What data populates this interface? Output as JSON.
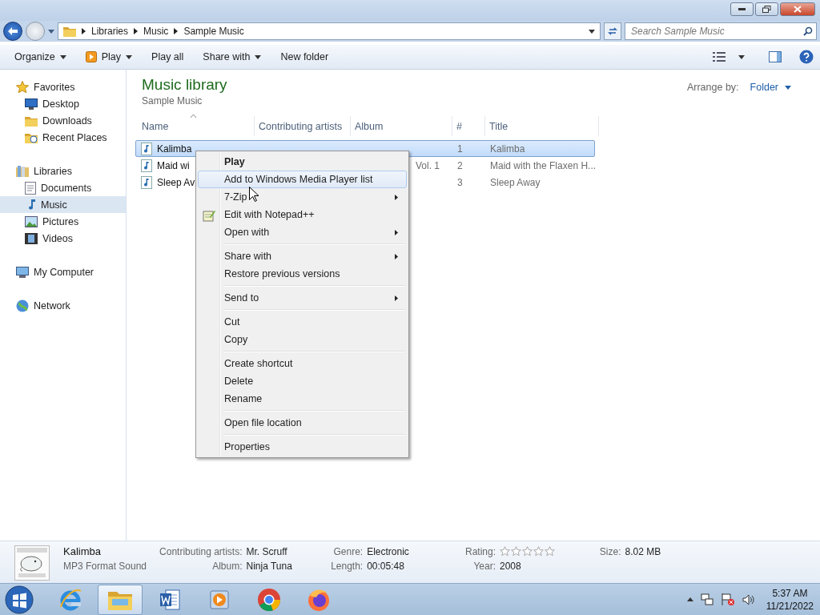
{
  "address": {
    "crumbs": [
      "Libraries",
      "Music",
      "Sample Music"
    ],
    "search_placeholder": "Search Sample Music"
  },
  "toolbar": {
    "items": [
      {
        "label": "Organize",
        "dropdown": true,
        "icon": false
      },
      {
        "label": "Play",
        "dropdown": true,
        "icon": true
      },
      {
        "label": "Play all",
        "dropdown": false,
        "icon": false
      },
      {
        "label": "Share with",
        "dropdown": true,
        "icon": false
      },
      {
        "label": "New folder",
        "dropdown": false,
        "icon": false
      }
    ]
  },
  "sidebar": {
    "groups": [
      {
        "label": "Favorites",
        "children": [
          {
            "label": "Desktop",
            "selected": false
          },
          {
            "label": "Downloads",
            "selected": false
          },
          {
            "label": "Recent Places",
            "selected": false
          }
        ]
      },
      {
        "label": "Libraries",
        "children": [
          {
            "label": "Documents",
            "selected": false
          },
          {
            "label": "Music",
            "selected": true
          },
          {
            "label": "Pictures",
            "selected": false
          },
          {
            "label": "Videos",
            "selected": false
          }
        ]
      },
      {
        "label": "My Computer"
      },
      {
        "label": "Network"
      }
    ]
  },
  "library": {
    "title": "Music library",
    "subtitle": "Sample Music",
    "arrange_label": "Arrange by:",
    "arrange_value": "Folder",
    "columns": [
      "Name",
      "Contributing artists",
      "Album",
      "#",
      "Title"
    ],
    "rows": [
      {
        "name": "Kalimba",
        "number": "1",
        "title": "Kalimba",
        "selected": true
      },
      {
        "name": "Maid wi",
        "album": "Vol. 1",
        "number": "2",
        "title": "Maid with the Flaxen H...",
        "selected": false
      },
      {
        "name": "Sleep Av",
        "number": "3",
        "title": "Sleep Away",
        "selected": false
      }
    ]
  },
  "context_menu": {
    "groups": [
      [
        {
          "label": "Play",
          "default": true,
          "submenu": false,
          "icon": false,
          "selected": false
        },
        {
          "label": "Add to Windows Media Player list",
          "default": false,
          "submenu": false,
          "icon": false,
          "selected": true
        },
        {
          "label": "7-Zip",
          "default": false,
          "submenu": true,
          "icon": false,
          "selected": false
        },
        {
          "label": "Edit with Notepad++",
          "default": false,
          "submenu": false,
          "icon": true,
          "selected": false
        },
        {
          "label": "Open with",
          "default": false,
          "submenu": true,
          "icon": false,
          "selected": false
        }
      ],
      [
        {
          "label": "Share with",
          "default": false,
          "submenu": true,
          "icon": false,
          "selected": false
        },
        {
          "label": "Restore previous versions",
          "default": false,
          "submenu": false,
          "icon": false,
          "selected": false
        }
      ],
      [
        {
          "label": "Send to",
          "default": false,
          "submenu": true,
          "icon": false,
          "selected": false
        }
      ],
      [
        {
          "label": "Cut",
          "default": false,
          "submenu": false,
          "icon": false,
          "selected": false
        },
        {
          "label": "Copy",
          "default": false,
          "submenu": false,
          "icon": false,
          "selected": false
        }
      ],
      [
        {
          "label": "Create shortcut",
          "default": false,
          "submenu": false,
          "icon": false,
          "selected": false
        },
        {
          "label": "Delete",
          "default": false,
          "submenu": false,
          "icon": false,
          "selected": false
        },
        {
          "label": "Rename",
          "default": false,
          "submenu": false,
          "icon": false,
          "selected": false
        }
      ],
      [
        {
          "label": "Open file location",
          "default": false,
          "submenu": false,
          "icon": false,
          "selected": false
        }
      ],
      [
        {
          "label": "Properties",
          "default": false,
          "submenu": false,
          "icon": false,
          "selected": false
        }
      ]
    ]
  },
  "details": {
    "name": "Kalimba",
    "type": "MP3 Format Sound",
    "columns": [
      [
        {
          "label": "Contributing artists:",
          "value": "Mr. Scruff"
        },
        {
          "label": "Album:",
          "value": "Ninja Tuna"
        }
      ],
      [
        {
          "label": "Genre:",
          "value": "Electronic"
        },
        {
          "label": "Length:",
          "value": "00:05:48"
        }
      ],
      [
        {
          "label": "Rating:",
          "stars": 0
        },
        {
          "label": "Year:",
          "value": "2008"
        }
      ],
      [
        {
          "label": "Size:",
          "value": "8.02 MB"
        }
      ]
    ]
  },
  "taskbar": {
    "apps": [
      {
        "selected": false
      },
      {
        "selected": true
      },
      {
        "selected": false
      },
      {
        "selected": false
      },
      {
        "selected": false
      },
      {
        "selected": false
      }
    ],
    "time": "5:37 AM",
    "date": "11/21/2022"
  }
}
